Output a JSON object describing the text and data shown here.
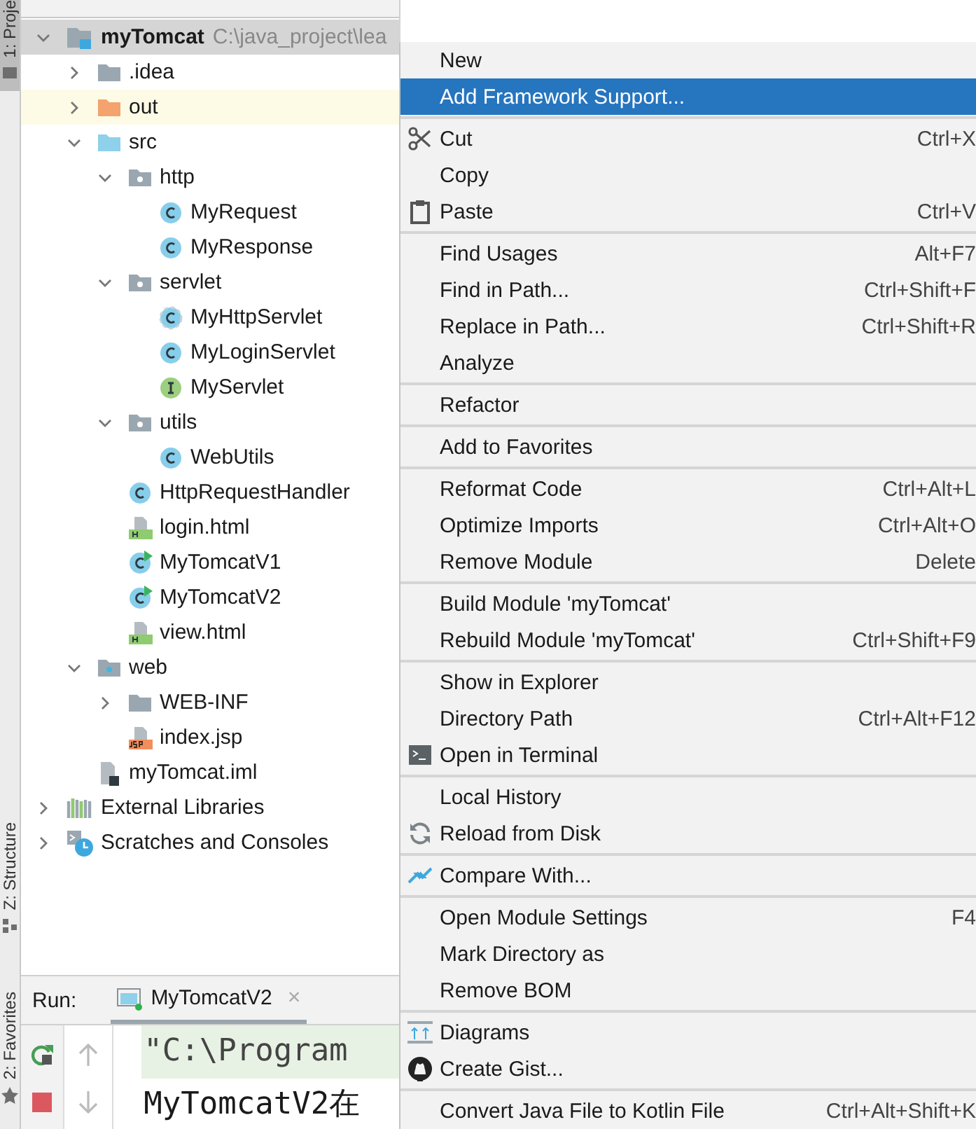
{
  "tool_strip": [
    {
      "label": "1: Proje",
      "kind": "project"
    },
    {
      "label": "Z: Structure",
      "kind": "structure"
    },
    {
      "label": "2: Favorites",
      "kind": "favorites"
    }
  ],
  "project_tree": [
    {
      "label": "myTomcat",
      "path": "C:\\java_project\\lea",
      "kind": "module",
      "selected": true,
      "expanded": true,
      "children": [
        {
          "label": ".idea",
          "kind": "folder",
          "selected": false,
          "expanded": false
        },
        {
          "label": "out",
          "kind": "excluded-folder",
          "selected": false,
          "expanded": false
        },
        {
          "label": "src",
          "kind": "source-folder",
          "selected": false,
          "expanded": true,
          "children": [
            {
              "label": "http",
              "kind": "package",
              "selected": false,
              "expanded": true,
              "children": [
                {
                  "label": "MyRequest",
                  "kind": "class",
                  "selected": false
                },
                {
                  "label": "MyResponse",
                  "kind": "class",
                  "selected": false
                }
              ]
            },
            {
              "label": "servlet",
              "kind": "package",
              "selected": false,
              "expanded": true,
              "children": [
                {
                  "label": "MyHttpServlet",
                  "kind": "abstract-class",
                  "selected": false
                },
                {
                  "label": "MyLoginServlet",
                  "kind": "class",
                  "selected": false
                },
                {
                  "label": "MyServlet",
                  "kind": "interface",
                  "selected": false
                }
              ]
            },
            {
              "label": "utils",
              "kind": "package",
              "selected": false,
              "expanded": true,
              "children": [
                {
                  "label": "WebUtils",
                  "kind": "class",
                  "selected": false
                }
              ]
            },
            {
              "label": "HttpRequestHandler",
              "kind": "class",
              "selected": false
            },
            {
              "label": "login.html",
              "kind": "html",
              "selected": false
            },
            {
              "label": "MyTomcatV1",
              "kind": "runnable-class",
              "selected": false
            },
            {
              "label": "MyTomcatV2",
              "kind": "runnable-class",
              "selected": false
            },
            {
              "label": "view.html",
              "kind": "html",
              "selected": false
            }
          ]
        },
        {
          "label": "web",
          "kind": "web-folder",
          "selected": false,
          "expanded": true,
          "children": [
            {
              "label": "WEB-INF",
              "kind": "folder",
              "selected": false,
              "expanded": false
            },
            {
              "label": "index.jsp",
              "kind": "jsp",
              "selected": false
            }
          ]
        },
        {
          "label": "myTomcat.iml",
          "kind": "iml",
          "selected": false
        }
      ]
    },
    {
      "label": "External Libraries",
      "kind": "libraries",
      "selected": false,
      "expanded": false
    },
    {
      "label": "Scratches and Consoles",
      "kind": "scratches",
      "selected": false,
      "expanded": false
    }
  ],
  "run_panel": {
    "label": "Run:",
    "tab": {
      "label": "MyTomcatV2",
      "close": "×",
      "selected": true
    },
    "console_lines": [
      {
        "text": "\"C:\\Program",
        "highlighted": true
      },
      {
        "text": "MyTomcatV2在",
        "highlighted": false
      }
    ]
  },
  "context_menu": {
    "groups": [
      [
        {
          "label": "New",
          "selected": false
        },
        {
          "label": "Add Framework Support...",
          "selected": true
        }
      ],
      [
        {
          "label": "Cut",
          "shortcut": "Ctrl+X",
          "kind": "scissors",
          "selected": false
        },
        {
          "label": "Copy",
          "selected": false
        },
        {
          "label": "Paste",
          "shortcut": "Ctrl+V",
          "kind": "clipboard",
          "selected": false
        }
      ],
      [
        {
          "label": "Find Usages",
          "shortcut": "Alt+F7",
          "selected": false
        },
        {
          "label": "Find in Path...",
          "shortcut": "Ctrl+Shift+F",
          "selected": false
        },
        {
          "label": "Replace in Path...",
          "shortcut": "Ctrl+Shift+R",
          "selected": false
        },
        {
          "label": "Analyze",
          "selected": false
        }
      ],
      [
        {
          "label": "Refactor",
          "selected": false
        }
      ],
      [
        {
          "label": "Add to Favorites",
          "selected": false
        }
      ],
      [
        {
          "label": "Reformat Code",
          "shortcut": "Ctrl+Alt+L",
          "selected": false
        },
        {
          "label": "Optimize Imports",
          "shortcut": "Ctrl+Alt+O",
          "selected": false
        },
        {
          "label": "Remove Module",
          "shortcut": "Delete",
          "selected": false
        }
      ],
      [
        {
          "label": "Build Module 'myTomcat'",
          "selected": false
        },
        {
          "label": "Rebuild Module 'myTomcat'",
          "shortcut": "Ctrl+Shift+F9",
          "selected": false
        }
      ],
      [
        {
          "label": "Show in Explorer",
          "selected": false
        },
        {
          "label": "Directory Path",
          "shortcut": "Ctrl+Alt+F12",
          "selected": false
        },
        {
          "label": "Open in Terminal",
          "kind": "terminal",
          "selected": false
        }
      ],
      [
        {
          "label": "Local History",
          "selected": false
        },
        {
          "label": "Reload from Disk",
          "kind": "reload",
          "selected": false
        }
      ],
      [
        {
          "label": "Compare With...",
          "kind": "compare",
          "selected": false
        }
      ],
      [
        {
          "label": "Open Module Settings",
          "shortcut": "F4",
          "selected": false
        },
        {
          "label": "Mark Directory as",
          "selected": false
        },
        {
          "label": "Remove BOM",
          "selected": false
        }
      ],
      [
        {
          "label": "Diagrams",
          "kind": "diagram",
          "selected": false
        },
        {
          "label": "Create Gist...",
          "kind": "cat",
          "selected": false
        }
      ],
      [
        {
          "label": "Convert Java File to Kotlin File",
          "shortcut": "Ctrl+Alt+Shift+K",
          "selected": false
        }
      ]
    ]
  }
}
